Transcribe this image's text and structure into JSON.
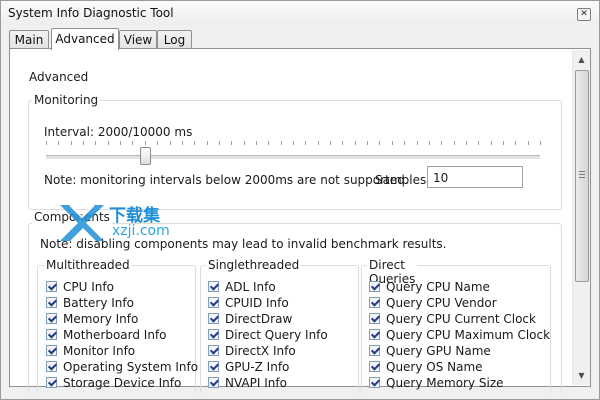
{
  "window": {
    "title": "System Info Diagnostic Tool",
    "close_glyph": "✕"
  },
  "tabs": [
    {
      "label": "Main",
      "active": false
    },
    {
      "label": "Advanced",
      "active": true
    },
    {
      "label": "View",
      "active": false
    },
    {
      "label": "Log",
      "active": false
    }
  ],
  "page": {
    "title": "Advanced"
  },
  "monitoring": {
    "group_label": "Monitoring",
    "interval_label": "Interval: 2000/10000 ms",
    "interval_value": 2000,
    "interval_max": 10000,
    "note": "Note: monitoring intervals below 2000ms are not supported.",
    "samples_label": "Samples:",
    "samples_value": "10"
  },
  "components": {
    "group_label": "Components",
    "note": "Note: disabling components may lead to invalid benchmark results.",
    "columns": [
      {
        "title": "Multithreaded",
        "items": [
          "CPU Info",
          "Battery Info",
          "Memory Info",
          "Motherboard Info",
          "Monitor Info",
          "Operating System Info",
          "Storage Device Info"
        ]
      },
      {
        "title": "Singlethreaded",
        "items": [
          "ADL Info",
          "CPUID Info",
          "DirectDraw",
          "Direct Query Info",
          "DirectX Info",
          "GPU-Z Info",
          "NVAPI Info"
        ]
      },
      {
        "title": "Direct Queries",
        "items": [
          "Query CPU Name",
          "Query CPU Vendor",
          "Query CPU Current Clock",
          "Query CPU Maximum Clock",
          "Query GPU Name",
          "Query OS Name",
          "Query Memory Size"
        ]
      }
    ]
  },
  "watermark": {
    "brand": "下载集",
    "url": "xzji.com"
  },
  "colors": {
    "accent": "#1e8fd6",
    "check": "#1e3b8c"
  },
  "icons": {
    "close": "close-icon",
    "scroll_up": "arrow-up-icon",
    "scroll_down": "arrow-down-icon"
  }
}
